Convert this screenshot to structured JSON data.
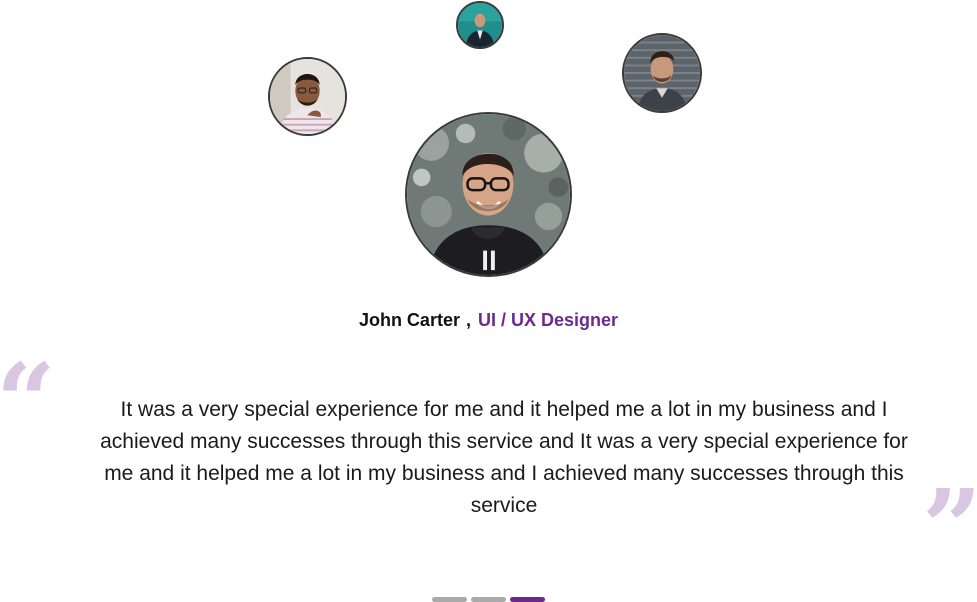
{
  "testimonial": {
    "name": "John Carter",
    "separator": ",",
    "role": "UI / UX Designer",
    "quote": "It was a very special experience for me and it helped me a lot in my business and I achieved many successes through this service and It was a very special experience for me and it helped me a lot in my business and I achieved many successes through this service",
    "open_quote_glyph": "“",
    "close_quote_glyph": "”"
  },
  "avatars": [
    {
      "id": "top",
      "icon": "person-photo"
    },
    {
      "id": "left",
      "icon": "person-photo"
    },
    {
      "id": "right",
      "icon": "person-photo"
    },
    {
      "id": "main",
      "icon": "person-photo"
    }
  ],
  "slider": {
    "total": 3,
    "active_index": 2
  },
  "colors": {
    "accent": "#6c2a8f",
    "quote_mark": "#d9c6e3",
    "inactive_dot": "#aaaaaa",
    "text": "#1a1a1a"
  }
}
